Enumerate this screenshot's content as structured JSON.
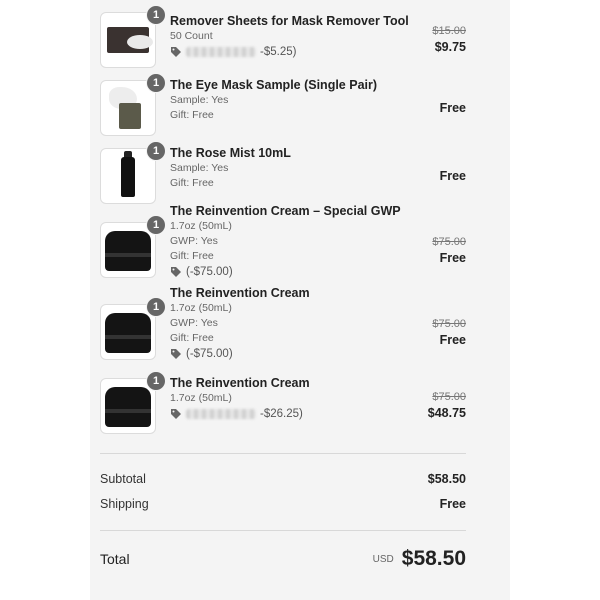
{
  "items": [
    {
      "quantity": "1",
      "name": "Remover Sheets for Mask Remover Tool",
      "meta": [
        "50 Count"
      ],
      "discount": "-$5.25)",
      "original_price": "$15.00",
      "price": "$9.75"
    },
    {
      "quantity": "1",
      "name": "The Eye Mask Sample (Single Pair)",
      "meta": [
        "Sample: Yes",
        "Gift: Free"
      ],
      "price": "Free"
    },
    {
      "quantity": "1",
      "name": "The Rose Mist 10mL",
      "meta": [
        "Sample: Yes",
        "Gift: Free"
      ],
      "price": "Free"
    },
    {
      "quantity": "1",
      "name": "The Reinvention Cream – Special GWP",
      "meta": [
        "1.7oz (50mL)",
        "GWP: Yes",
        "Gift: Free"
      ],
      "discount": "(-$75.00)",
      "original_price": "$75.00",
      "price": "Free"
    },
    {
      "quantity": "1",
      "name": "The Reinvention Cream",
      "meta": [
        "1.7oz (50mL)",
        "GWP: Yes",
        "Gift: Free"
      ],
      "discount": "(-$75.00)",
      "original_price": "$75.00",
      "price": "Free"
    },
    {
      "quantity": "1",
      "name": "The Reinvention Cream",
      "meta": [
        "1.7oz (50mL)"
      ],
      "discount": "-$26.25)",
      "original_price": "$75.00",
      "price": "$48.75"
    }
  ],
  "summary": {
    "subtotal_label": "Subtotal",
    "subtotal_value": "$58.50",
    "shipping_label": "Shipping",
    "shipping_value": "Free",
    "total_label": "Total",
    "currency": "USD",
    "total_value": "$58.50"
  },
  "icons": {
    "discount": "tag-icon"
  }
}
